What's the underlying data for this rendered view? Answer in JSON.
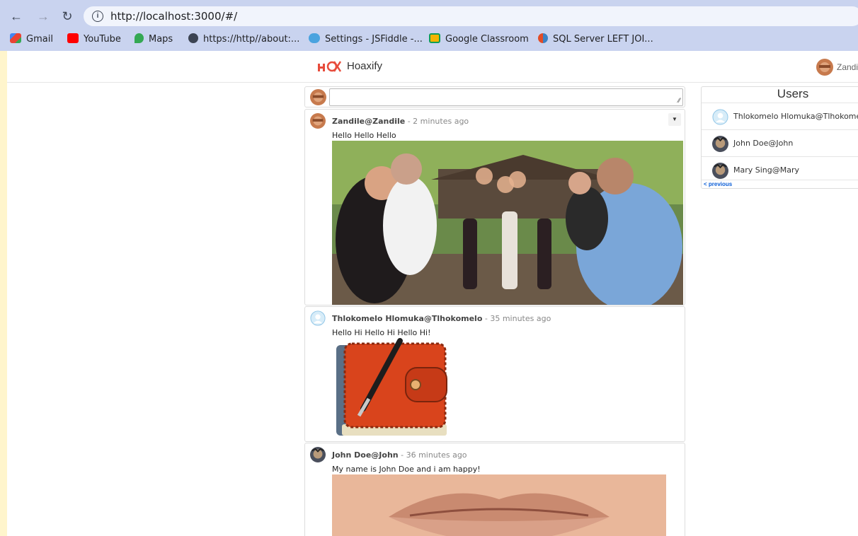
{
  "browser": {
    "url": "http://localhost:3000/#/",
    "bookmarks": [
      {
        "label": "Gmail",
        "icon": "gmail-icon",
        "color": "#ea4335"
      },
      {
        "label": "YouTube",
        "icon": "youtube-icon",
        "color": "#ff0000"
      },
      {
        "label": "Maps",
        "icon": "maps-icon",
        "color": "#34a853"
      },
      {
        "label": "https://http//about:...",
        "icon": "globe-icon",
        "color": "#3c4453"
      },
      {
        "label": "Settings - JSFiddle -...",
        "icon": "cloud-icon",
        "color": "#4aa3df"
      },
      {
        "label": "Google Classroom",
        "icon": "classroom-icon",
        "color": "#f4b400"
      },
      {
        "label": "SQL Server LEFT JOI...",
        "icon": "sql-icon",
        "color": "#e34c26"
      }
    ]
  },
  "app": {
    "brand": "Hoaxify",
    "logo_color": "#e74c3c",
    "current_user": "Zandi"
  },
  "composer": {
    "placeholder": ""
  },
  "feed": [
    {
      "author": "Zandile@Zandile",
      "time": " - 2 minutes ago",
      "content": "Hello Hello Hello",
      "image": "wine-toast-photo"
    },
    {
      "author": "Thlokomelo Hlomuka@Tlhokomelo",
      "time": " - 35 minutes ago",
      "content": "Hello Hi Hello Hi Hello Hi!",
      "image": "notebook-pen-icon"
    },
    {
      "author": "John Doe@John",
      "time": " - 36 minutes ago",
      "content": "My name is John Doe and i am happy!",
      "image": "lips-photo"
    }
  ],
  "users": {
    "title": "Users",
    "items": [
      {
        "name": "Thlokomelo Hlomuka@Tlhokomelo"
      },
      {
        "name": "John Doe@John"
      },
      {
        "name": "Mary Sing@Mary"
      }
    ],
    "previous_label": "< previous"
  }
}
